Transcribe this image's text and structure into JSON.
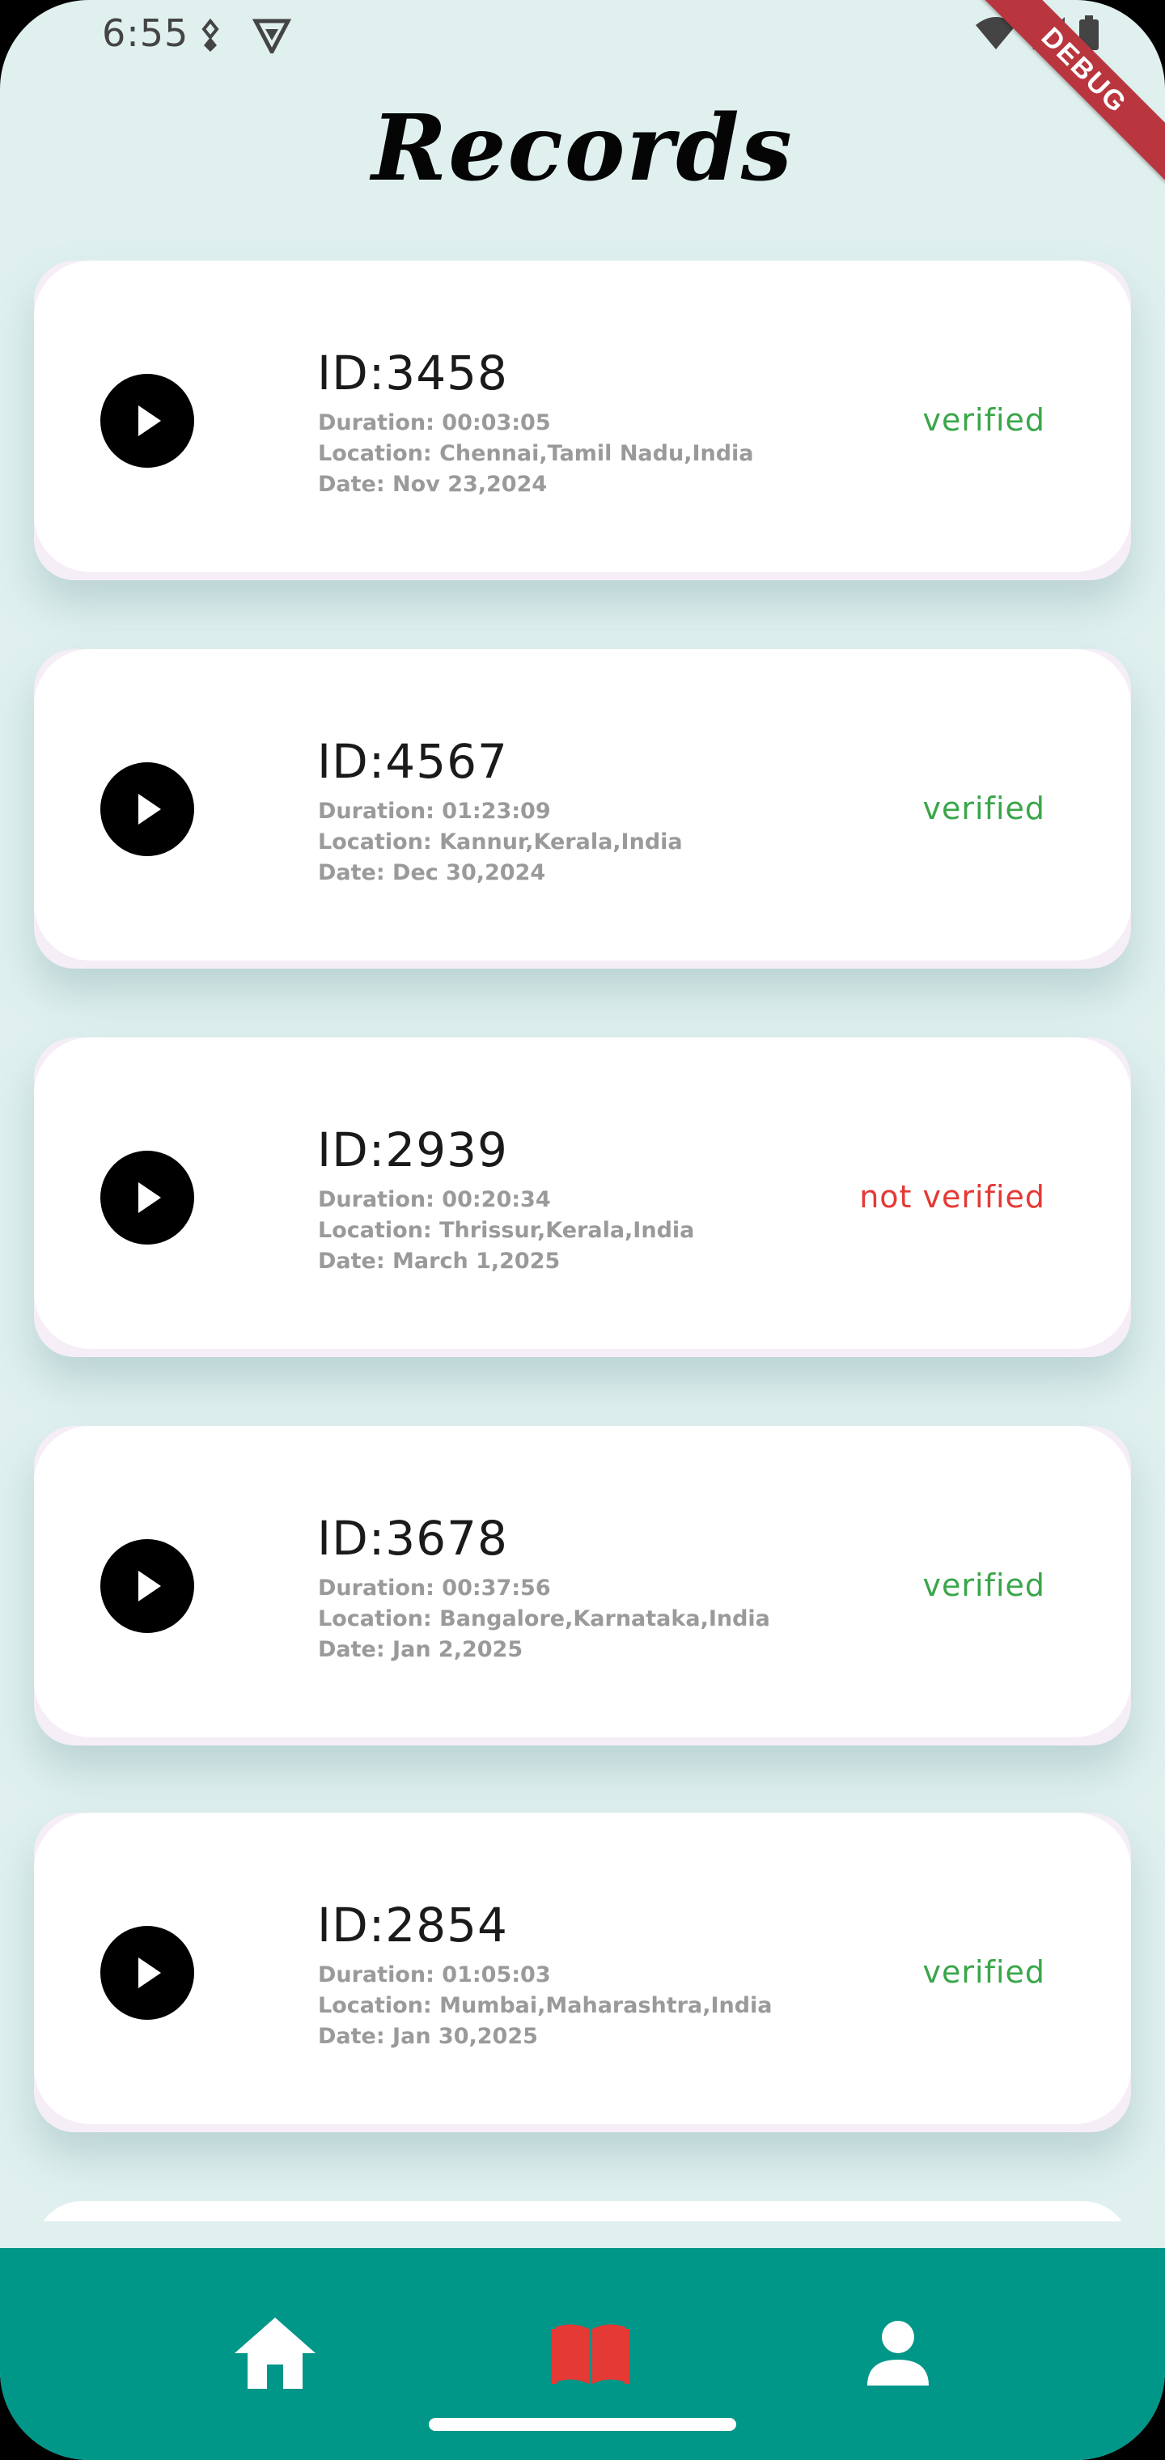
{
  "status_bar": {
    "time": "6:55",
    "left_icons": [
      "debug-bug-icon",
      "vpn-shield-icon"
    ],
    "right_icons": [
      "wifi-icon",
      "signal-icon",
      "battery-icon"
    ]
  },
  "debug_banner": "DEBUG",
  "page": {
    "title": "Records"
  },
  "colors": {
    "background": "#dff0ef",
    "card": "#ffffff",
    "verified": "#3aa64a",
    "not_verified": "#e53935",
    "nav": "#009688",
    "nav_active": "#e53935"
  },
  "records": [
    {
      "id": "ID:3458",
      "duration": "Duration: 00:03:05",
      "location": "Location: Chennai,Tamil Nadu,India",
      "date": "Date: Nov 23,2024",
      "status": "verified"
    },
    {
      "id": "ID:4567",
      "duration": "Duration: 01:23:09",
      "location": "Location: Kannur,Kerala,India",
      "date": "Date: Dec 30,2024",
      "status": "verified"
    },
    {
      "id": "ID:2939",
      "duration": "Duration: 00:20:34",
      "location": "Location: Thrissur,Kerala,India",
      "date": "Date: March 1,2025",
      "status": "not verified"
    },
    {
      "id": "ID:3678",
      "duration": "Duration: 00:37:56",
      "location": "Location: Bangalore,Karnataka,India",
      "date": "Date: Jan 2,2025",
      "status": "verified"
    },
    {
      "id": "ID:2854",
      "duration": "Duration: 01:05:03",
      "location": "Location: Mumbai,Maharashtra,India",
      "date": "Date: Jan 30,2025",
      "status": "verified"
    }
  ],
  "bottom_nav": {
    "items": [
      {
        "icon": "home-icon",
        "active": false
      },
      {
        "icon": "book-icon",
        "active": true
      },
      {
        "icon": "person-icon",
        "active": false
      }
    ]
  }
}
